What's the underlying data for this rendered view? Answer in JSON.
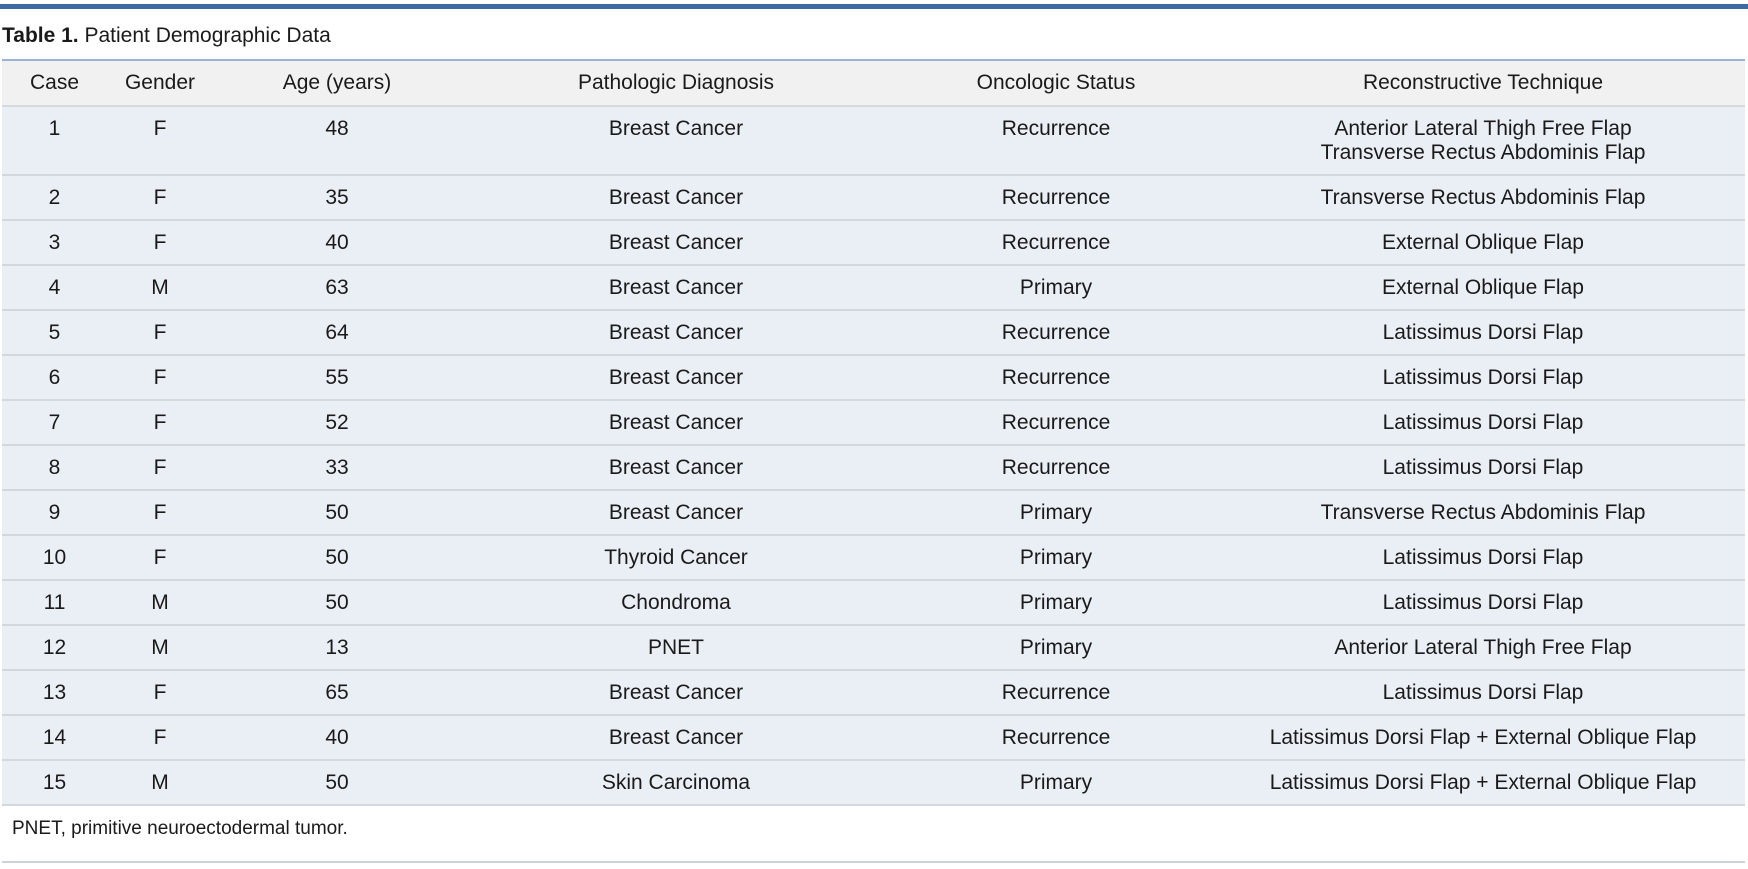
{
  "document": {
    "caption_label": "Table 1.",
    "caption_title": "Patient Demographic Data",
    "accent_color": "#3d6aa0",
    "footnote": "PNET, primitive neuroectodermal tumor."
  },
  "table": {
    "headers": [
      "Case",
      "Gender",
      "Age (years)",
      "Pathologic Diagnosis",
      "Oncologic Status",
      "Reconstructive Technique"
    ],
    "rows": [
      {
        "case": "1",
        "gender": "F",
        "age": "48",
        "diagnosis": "Breast Cancer",
        "status": "Recurrence",
        "technique": "Anterior Lateral Thigh Free Flap",
        "technique_line2": "Transverse Rectus Abdominis Flap"
      },
      {
        "case": "2",
        "gender": "F",
        "age": "35",
        "diagnosis": "Breast Cancer",
        "status": "Recurrence",
        "technique": "Transverse Rectus Abdominis Flap"
      },
      {
        "case": "3",
        "gender": "F",
        "age": "40",
        "diagnosis": "Breast Cancer",
        "status": "Recurrence",
        "technique": "External Oblique Flap"
      },
      {
        "case": "4",
        "gender": "M",
        "age": "63",
        "diagnosis": "Breast Cancer",
        "status": "Primary",
        "technique": "External Oblique Flap"
      },
      {
        "case": "5",
        "gender": "F",
        "age": "64",
        "diagnosis": "Breast Cancer",
        "status": "Recurrence",
        "technique": "Latissimus Dorsi Flap"
      },
      {
        "case": "6",
        "gender": "F",
        "age": "55",
        "diagnosis": "Breast Cancer",
        "status": "Recurrence",
        "technique": "Latissimus Dorsi Flap"
      },
      {
        "case": "7",
        "gender": "F",
        "age": "52",
        "diagnosis": "Breast Cancer",
        "status": "Recurrence",
        "technique": "Latissimus Dorsi Flap"
      },
      {
        "case": "8",
        "gender": "F",
        "age": "33",
        "diagnosis": "Breast Cancer",
        "status": "Recurrence",
        "technique": "Latissimus Dorsi Flap"
      },
      {
        "case": "9",
        "gender": "F",
        "age": "50",
        "diagnosis": "Breast Cancer",
        "status": "Primary",
        "technique": "Transverse Rectus Abdominis Flap"
      },
      {
        "case": "10",
        "gender": "F",
        "age": "50",
        "diagnosis": "Thyroid Cancer",
        "status": "Primary",
        "technique": "Latissimus Dorsi Flap"
      },
      {
        "case": "11",
        "gender": "M",
        "age": "50",
        "diagnosis": "Chondroma",
        "status": "Primary",
        "technique": "Latissimus Dorsi Flap"
      },
      {
        "case": "12",
        "gender": "M",
        "age": "13",
        "diagnosis": "PNET",
        "status": "Primary",
        "technique": "Anterior Lateral Thigh Free Flap"
      },
      {
        "case": "13",
        "gender": "F",
        "age": "65",
        "diagnosis": "Breast Cancer",
        "status": "Recurrence",
        "technique": "Latissimus Dorsi Flap"
      },
      {
        "case": "14",
        "gender": "F",
        "age": "40",
        "diagnosis": "Breast Cancer",
        "status": "Recurrence",
        "technique": "Latissimus Dorsi Flap + External Oblique Flap"
      },
      {
        "case": "15",
        "gender": "M",
        "age": "50",
        "diagnosis": "Skin Carcinoma",
        "status": "Primary",
        "technique": "Latissimus Dorsi Flap + External Oblique Flap"
      }
    ]
  }
}
